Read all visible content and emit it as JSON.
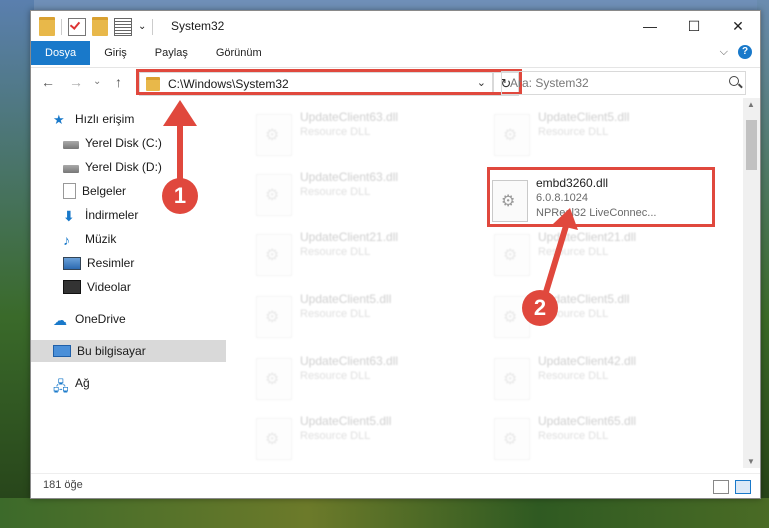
{
  "window": {
    "title": "System32",
    "min_glyph": "—",
    "max_glyph": "☐",
    "close_glyph": "✕"
  },
  "ribbon": {
    "tabs": [
      "Dosya",
      "Giriş",
      "Paylaş",
      "Görünüm"
    ],
    "expand_glyph": "⌵",
    "help_glyph": "?"
  },
  "address": {
    "path": "C:\\Windows\\System32",
    "search_placeholder": "Ara: System32",
    "back_glyph": "←",
    "forward_glyph": "→",
    "recent_glyph": "⌄",
    "up_glyph": "↑",
    "dropdown_glyph": "⌄",
    "refresh_glyph": "↻"
  },
  "nav": {
    "quick_access": "Hızlı erişim",
    "items": [
      "Yerel Disk (C:)",
      "Yerel Disk (D:)",
      "Belgeler",
      "İndirmeler",
      "Müzik",
      "Resimler",
      "Videolar"
    ],
    "onedrive": "OneDrive",
    "this_pc": "Bu bilgisayar",
    "network": "Ağ"
  },
  "files": [
    {
      "name": "UpdateClient63.dll",
      "sub": "Resource DLL"
    },
    {
      "name": "UpdateClient5.dll",
      "sub": "Resource DLL"
    },
    {
      "name": "UpdateClient63.dll",
      "sub": "Resource DLL"
    },
    {
      "name": "embd3260.dll",
      "version": "6.0.8.1024",
      "desc": "NPReal32 LiveConnec..."
    },
    {
      "name": "UpdateClient21.dll",
      "sub": "Resource DLL"
    },
    {
      "name": "UpdateClient21.dll",
      "sub": "Resource DLL"
    },
    {
      "name": "UpdateClient5.dll",
      "sub": "Resource DLL"
    },
    {
      "name": "UpdateClient5.dll",
      "sub": "Resource DLL"
    },
    {
      "name": "UpdateClient63.dll",
      "sub": "Resource DLL"
    },
    {
      "name": "UpdateClient42.dll",
      "sub": "Resource DLL"
    },
    {
      "name": "UpdateClient5.dll",
      "sub": "Resource DLL"
    },
    {
      "name": "UpdateClient65.dll",
      "sub": "Resource DLL"
    }
  ],
  "status": {
    "count": "181 öğe"
  },
  "callouts": {
    "one": "1",
    "two": "2"
  },
  "colors": {
    "accent": "#1979ca",
    "highlight": "#e0483d"
  }
}
